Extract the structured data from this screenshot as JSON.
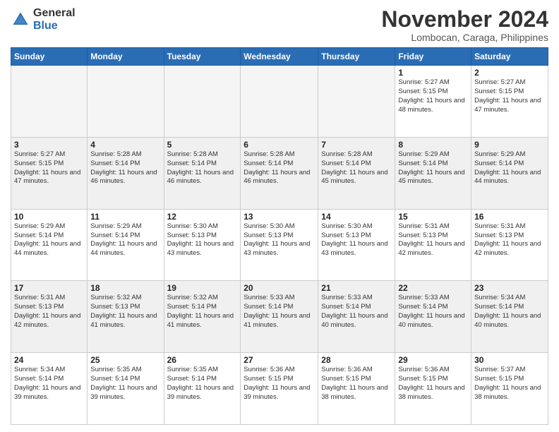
{
  "header": {
    "logo_general": "General",
    "logo_blue": "Blue",
    "month_title": "November 2024",
    "location": "Lombocan, Caraga, Philippines"
  },
  "weekdays": [
    "Sunday",
    "Monday",
    "Tuesday",
    "Wednesday",
    "Thursday",
    "Friday",
    "Saturday"
  ],
  "weeks": [
    [
      {
        "day": "",
        "empty": true
      },
      {
        "day": "",
        "empty": true
      },
      {
        "day": "",
        "empty": true
      },
      {
        "day": "",
        "empty": true
      },
      {
        "day": "",
        "empty": true
      },
      {
        "day": "1",
        "sunrise": "5:27 AM",
        "sunset": "5:15 PM",
        "daylight": "11 hours and 48 minutes."
      },
      {
        "day": "2",
        "sunrise": "5:27 AM",
        "sunset": "5:15 PM",
        "daylight": "11 hours and 47 minutes."
      }
    ],
    [
      {
        "day": "3",
        "sunrise": "5:27 AM",
        "sunset": "5:15 PM",
        "daylight": "11 hours and 47 minutes."
      },
      {
        "day": "4",
        "sunrise": "5:28 AM",
        "sunset": "5:14 PM",
        "daylight": "11 hours and 46 minutes."
      },
      {
        "day": "5",
        "sunrise": "5:28 AM",
        "sunset": "5:14 PM",
        "daylight": "11 hours and 46 minutes."
      },
      {
        "day": "6",
        "sunrise": "5:28 AM",
        "sunset": "5:14 PM",
        "daylight": "11 hours and 46 minutes."
      },
      {
        "day": "7",
        "sunrise": "5:28 AM",
        "sunset": "5:14 PM",
        "daylight": "11 hours and 45 minutes."
      },
      {
        "day": "8",
        "sunrise": "5:29 AM",
        "sunset": "5:14 PM",
        "daylight": "11 hours and 45 minutes."
      },
      {
        "day": "9",
        "sunrise": "5:29 AM",
        "sunset": "5:14 PM",
        "daylight": "11 hours and 44 minutes."
      }
    ],
    [
      {
        "day": "10",
        "sunrise": "5:29 AM",
        "sunset": "5:14 PM",
        "daylight": "11 hours and 44 minutes."
      },
      {
        "day": "11",
        "sunrise": "5:29 AM",
        "sunset": "5:14 PM",
        "daylight": "11 hours and 44 minutes."
      },
      {
        "day": "12",
        "sunrise": "5:30 AM",
        "sunset": "5:13 PM",
        "daylight": "11 hours and 43 minutes."
      },
      {
        "day": "13",
        "sunrise": "5:30 AM",
        "sunset": "5:13 PM",
        "daylight": "11 hours and 43 minutes."
      },
      {
        "day": "14",
        "sunrise": "5:30 AM",
        "sunset": "5:13 PM",
        "daylight": "11 hours and 43 minutes."
      },
      {
        "day": "15",
        "sunrise": "5:31 AM",
        "sunset": "5:13 PM",
        "daylight": "11 hours and 42 minutes."
      },
      {
        "day": "16",
        "sunrise": "5:31 AM",
        "sunset": "5:13 PM",
        "daylight": "11 hours and 42 minutes."
      }
    ],
    [
      {
        "day": "17",
        "sunrise": "5:31 AM",
        "sunset": "5:13 PM",
        "daylight": "11 hours and 42 minutes."
      },
      {
        "day": "18",
        "sunrise": "5:32 AM",
        "sunset": "5:13 PM",
        "daylight": "11 hours and 41 minutes."
      },
      {
        "day": "19",
        "sunrise": "5:32 AM",
        "sunset": "5:14 PM",
        "daylight": "11 hours and 41 minutes."
      },
      {
        "day": "20",
        "sunrise": "5:33 AM",
        "sunset": "5:14 PM",
        "daylight": "11 hours and 41 minutes."
      },
      {
        "day": "21",
        "sunrise": "5:33 AM",
        "sunset": "5:14 PM",
        "daylight": "11 hours and 40 minutes."
      },
      {
        "day": "22",
        "sunrise": "5:33 AM",
        "sunset": "5:14 PM",
        "daylight": "11 hours and 40 minutes."
      },
      {
        "day": "23",
        "sunrise": "5:34 AM",
        "sunset": "5:14 PM",
        "daylight": "11 hours and 40 minutes."
      }
    ],
    [
      {
        "day": "24",
        "sunrise": "5:34 AM",
        "sunset": "5:14 PM",
        "daylight": "11 hours and 39 minutes."
      },
      {
        "day": "25",
        "sunrise": "5:35 AM",
        "sunset": "5:14 PM",
        "daylight": "11 hours and 39 minutes."
      },
      {
        "day": "26",
        "sunrise": "5:35 AM",
        "sunset": "5:14 PM",
        "daylight": "11 hours and 39 minutes."
      },
      {
        "day": "27",
        "sunrise": "5:36 AM",
        "sunset": "5:15 PM",
        "daylight": "11 hours and 39 minutes."
      },
      {
        "day": "28",
        "sunrise": "5:36 AM",
        "sunset": "5:15 PM",
        "daylight": "11 hours and 38 minutes."
      },
      {
        "day": "29",
        "sunrise": "5:36 AM",
        "sunset": "5:15 PM",
        "daylight": "11 hours and 38 minutes."
      },
      {
        "day": "30",
        "sunrise": "5:37 AM",
        "sunset": "5:15 PM",
        "daylight": "11 hours and 38 minutes."
      }
    ]
  ]
}
